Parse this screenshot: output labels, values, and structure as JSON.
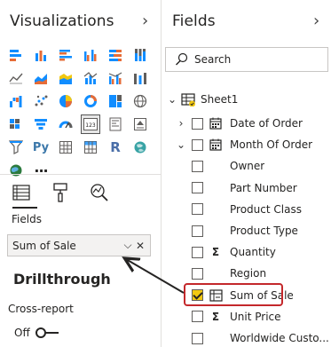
{
  "visualizations": {
    "title": "Visualizations",
    "expand_icon": "chevron-right-icon",
    "icons": [
      "stacked-bar-chart-icon",
      "stacked-column-chart-icon",
      "clustered-bar-chart-icon",
      "clustered-column-chart-icon",
      "100-stacked-bar-chart-icon",
      "100-stacked-column-chart-icon",
      "line-chart-icon",
      "area-chart-icon",
      "stacked-area-chart-icon",
      "line-and-column-chart-icon",
      "line-and-clustered-column-chart-icon",
      "ribbon-chart-icon",
      "waterfall-chart-icon",
      "scatter-chart-icon",
      "pie-chart-icon",
      "donut-chart-icon",
      "treemap-icon",
      "map-icon",
      "filled-map-icon",
      "funnel-icon",
      "gauge-icon",
      "card-icon",
      "multi-row-card-icon",
      "kpi-icon",
      "slicer-icon",
      "python-visual-icon",
      "table-icon",
      "matrix-icon",
      "r-visual-icon",
      "arcgis-map-icon",
      "globe-icon",
      "more-icon"
    ],
    "python_glyph": "Py",
    "r_glyph": "R",
    "card_glyph": "123",
    "more_glyph": "···",
    "tools": [
      "fields-tool-icon",
      "format-tool-icon",
      "analytics-tool-icon"
    ],
    "fields_label": "Fields",
    "field_well": {
      "value": "Sum of Sale",
      "dropdown_glyph": "⌵",
      "remove_glyph": "✕"
    },
    "drillthrough": {
      "title": "Drillthrough",
      "cross_report_label": "Cross-report",
      "toggle_label": "Off",
      "toggle_on": false
    }
  },
  "fields": {
    "title": "Fields",
    "expand_icon": "chevron-right-icon",
    "search": {
      "placeholder": "Search",
      "value": ""
    },
    "table": {
      "name": "Sheet1",
      "expanded": true
    },
    "items": [
      {
        "label": "Date of Order",
        "checked": false,
        "icon": "calendar-icon",
        "expander": "›",
        "glyph": ""
      },
      {
        "label": "Month Of Order",
        "checked": false,
        "icon": "calendar-icon",
        "expander": "⌄",
        "glyph": ""
      },
      {
        "label": "Owner",
        "checked": false,
        "icon": "",
        "expander": "",
        "glyph": ""
      },
      {
        "label": "Part Number",
        "checked": false,
        "icon": "",
        "expander": "",
        "glyph": ""
      },
      {
        "label": "Product Class",
        "checked": false,
        "icon": "",
        "expander": "",
        "glyph": ""
      },
      {
        "label": "Product Type",
        "checked": false,
        "icon": "",
        "expander": "",
        "glyph": ""
      },
      {
        "label": "Quantity",
        "checked": false,
        "icon": "sigma-icon",
        "expander": "",
        "glyph": "Σ"
      },
      {
        "label": "Region",
        "checked": false,
        "icon": "",
        "expander": "",
        "glyph": ""
      },
      {
        "label": "Sum of Sale",
        "checked": true,
        "icon": "measure-icon",
        "expander": "",
        "glyph": ""
      },
      {
        "label": "Unit Price",
        "checked": false,
        "icon": "sigma-icon",
        "expander": "",
        "glyph": "Σ"
      },
      {
        "label": "Worldwide Custo...",
        "checked": false,
        "icon": "",
        "expander": "",
        "glyph": ""
      }
    ]
  },
  "colors": {
    "accent_yellow": "#f2c811",
    "highlight_red": "#c4282b",
    "chart_blue": "#118dff",
    "chart_orange": "#e66c37",
    "chart_gray": "#605e5c"
  }
}
